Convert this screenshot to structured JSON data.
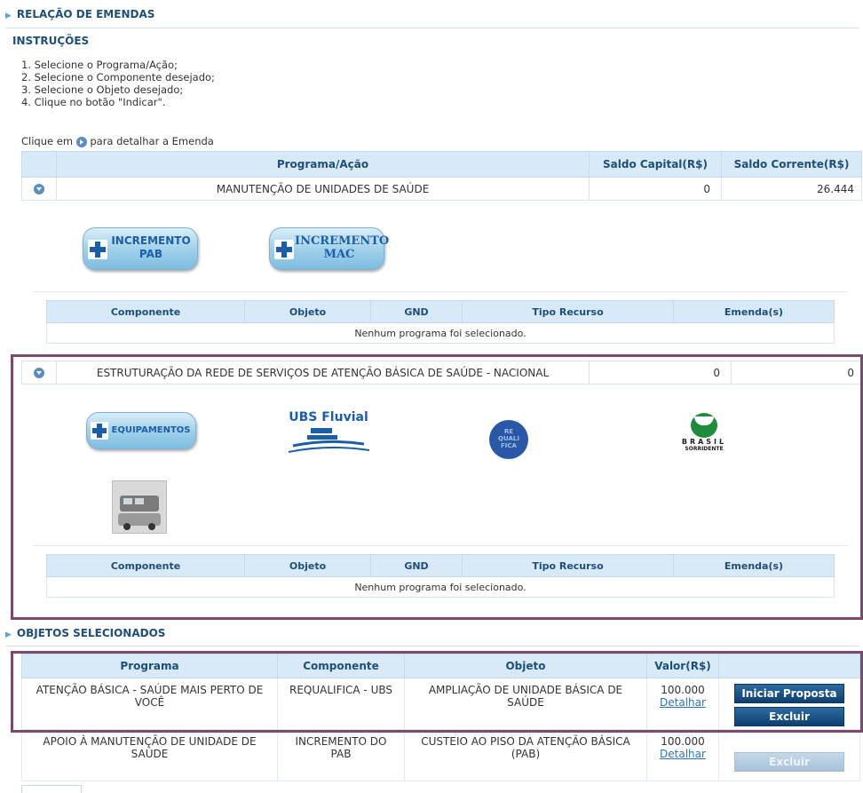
{
  "sections": {
    "relacao": "RELAÇÃO DE EMENDAS",
    "objetos": "OBJETOS SELECIONADOS"
  },
  "instructions": {
    "title": "INSTRUÇÕES",
    "steps": [
      "1. Selecione o Programa/Ação;",
      "2. Selecione o Componente desejado;",
      "3. Selecione o Objeto desejado;",
      "4. Clique no botão \"Indicar\"."
    ],
    "hint_before": "Clique em",
    "hint_after": "para detalhar a Emenda"
  },
  "main_table": {
    "headers": [
      "Programa/Ação",
      "Saldo Capital(R$)",
      "Saldo Corrente(R$)"
    ],
    "rows": [
      {
        "programa": "MANUTENÇÃO DE UNIDADES DE SAÚDE",
        "saldo_capital": "0",
        "saldo_corrente": "26.444"
      },
      {
        "programa": "ESTRUTURAÇÃO DA REDE DE SERVIÇOS DE ATENÇÃO BÁSICA DE SAÚDE - NACIONAL",
        "saldo_capital": "0",
        "saldo_corrente": "0"
      }
    ]
  },
  "component_buttons": {
    "incremento_pab": [
      "INCREMENTO",
      "PAB"
    ],
    "incremento_mac": [
      "INCREMENTO",
      "MAC"
    ],
    "equipamentos": "EQUIPAMENTOS",
    "ubs_fluvial": "UBS Fluvial",
    "requalifica": [
      "RE",
      "QUALI",
      "FICA"
    ],
    "brasil_sorridente": [
      "BRASIL",
      "SORRIDENTE"
    ]
  },
  "sub_table": {
    "headers": [
      "Componente",
      "Objeto",
      "GND",
      "Tipo Recurso",
      "Emenda(s)"
    ],
    "empty": "Nenhum programa foi selecionado."
  },
  "objetos_table": {
    "headers": [
      "Programa",
      "Componente",
      "Objeto",
      "Valor(R$)",
      ""
    ],
    "rows": [
      {
        "programa": "ATENÇÃO BÁSICA - SAÚDE MAIS PERTO DE VOCÊ",
        "componente": "REQUALIFICA - UBS",
        "objeto": "AMPLIAÇÃO DE UNIDADE BÁSICA DE SAÚDE",
        "valor": "100.000",
        "detalhar": "Detalhar",
        "btn_iniciar": "Iniciar Proposta",
        "btn_excluir": "Excluir"
      },
      {
        "programa": "APOIO À MANUTENÇÃO DE UNIDADE DE SAÚDE",
        "componente": "INCREMENTO DO PAB",
        "objeto": "CUSTEIO AO PISO DA ATENÇÃO BÁSICA (PAB)",
        "valor": "100.000",
        "detalhar": "Detalhar",
        "btn_excluir": "Excluir"
      }
    ]
  },
  "colors": {
    "header_bg": "#d8e9f7",
    "header_text": "#1f4e79",
    "frame": "#7b4a6e",
    "button": "#0f3f70"
  }
}
